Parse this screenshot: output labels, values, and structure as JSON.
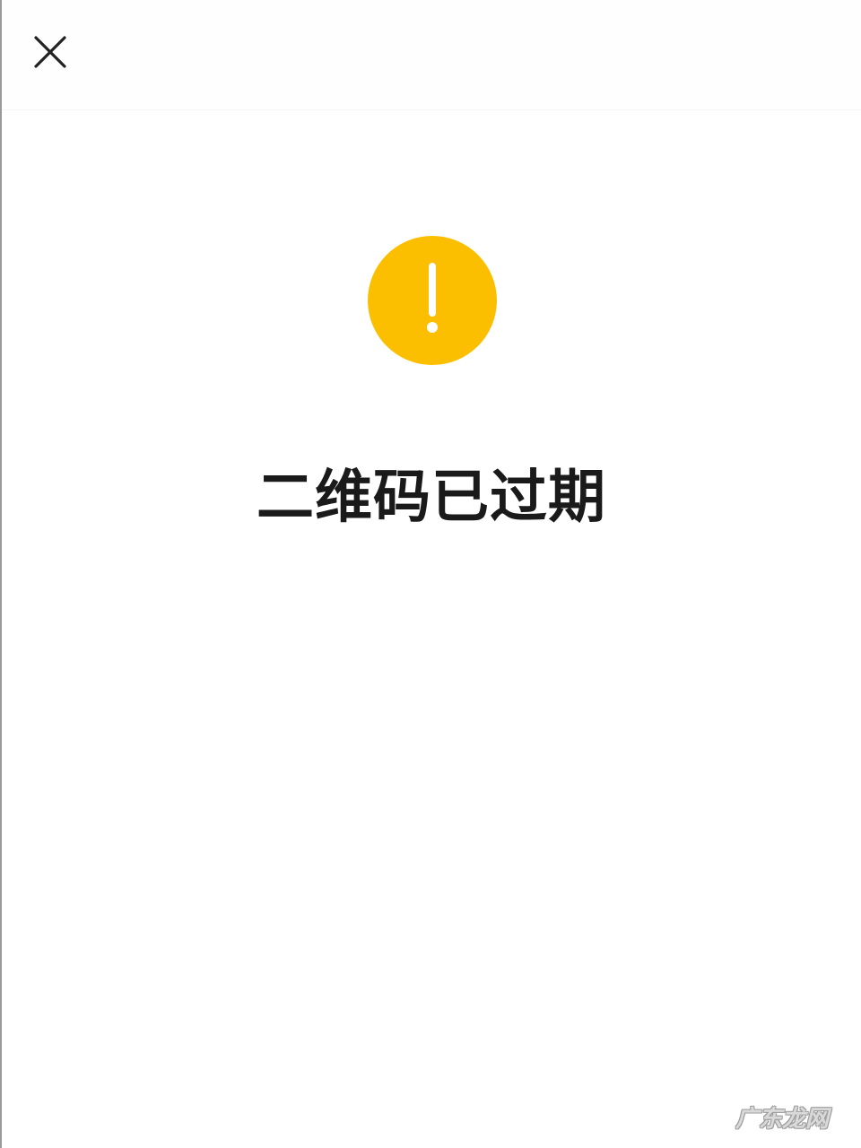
{
  "header": {
    "close_icon": "close-icon"
  },
  "status": {
    "icon": "exclamation-icon",
    "icon_color": "#fbbf00",
    "title": "二维码已过期"
  },
  "watermark": {
    "text": "广东龙网"
  }
}
